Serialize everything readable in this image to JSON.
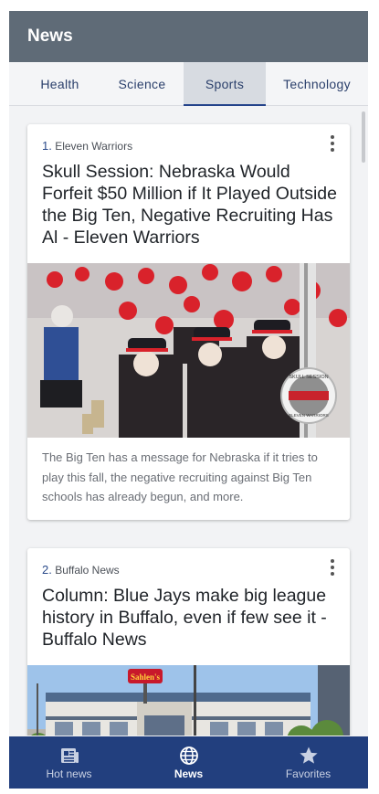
{
  "appbar": {
    "title": "News"
  },
  "tabs": [
    {
      "label": "Health",
      "active": false
    },
    {
      "label": "Science",
      "active": false
    },
    {
      "label": "Sports",
      "active": true
    },
    {
      "label": "Technology",
      "active": false
    }
  ],
  "articles": [
    {
      "number": "1.",
      "source": "Eleven Warriors",
      "title": "Skull Session: Nebraska Would Forfeit $50 Million if It Played Outside the Big Ten, Negative Recruiting Has Al - Eleven Warriors",
      "description": "The Big Ten has a message for Nebraska if it tries to play this fall, the negative recruiting against Big Ten schools has already begun, and more.",
      "image_badge_top": "SKULL SESSION",
      "image_badge_bottom": "ELEVEN WARRIORS"
    },
    {
      "number": "2.",
      "source": "Buffalo News",
      "title": "Column: Blue Jays make big league history in Buffalo, even if few see it - Buffalo News",
      "image_sign": "Sahlen's"
    }
  ],
  "bottom_nav": [
    {
      "label": "Hot news",
      "icon": "newspaper-icon",
      "active": false
    },
    {
      "label": "News",
      "icon": "globe-icon",
      "active": true
    },
    {
      "label": "Favorites",
      "icon": "star-icon",
      "active": false
    }
  ],
  "colors": {
    "appbar": "#5f6b77",
    "tab_indicator": "#23428a",
    "bottom_nav": "#223f7e"
  }
}
